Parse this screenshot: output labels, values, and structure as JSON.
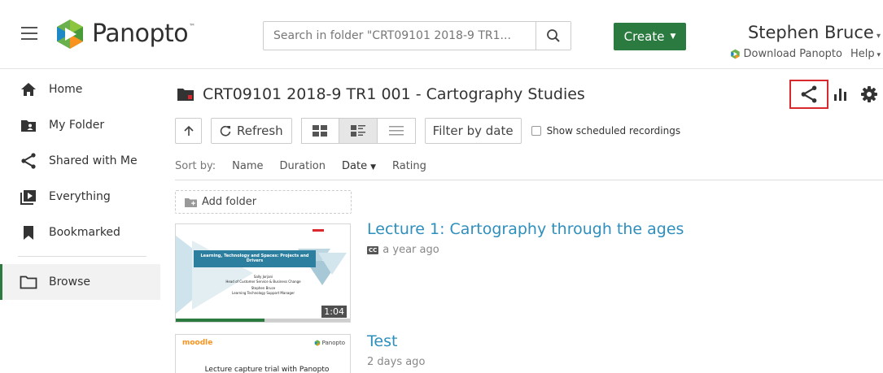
{
  "header": {
    "logo_text": "Panopto",
    "search_placeholder": "Search in folder \"CRT09101 2018-9 TR1...",
    "create_label": "Create",
    "user_name": "Stephen Bruce",
    "download_label": "Download Panopto",
    "help_label": "Help"
  },
  "sidebar": {
    "items": [
      {
        "label": "Home",
        "icon": "home-icon"
      },
      {
        "label": "My Folder",
        "icon": "user-folder-icon"
      },
      {
        "label": "Shared with Me",
        "icon": "share-icon"
      },
      {
        "label": "Everything",
        "icon": "play-box-icon"
      },
      {
        "label": "Bookmarked",
        "icon": "bookmark-icon"
      },
      {
        "label": "Browse",
        "icon": "folder-icon"
      }
    ]
  },
  "main": {
    "folder_title": "CRT09101 2018-9 TR1 001 - Cartography Studies",
    "refresh_label": "Refresh",
    "filter_label": "Filter by date",
    "scheduled_label": "Show scheduled recordings",
    "sort_label": "Sort by:",
    "sort_options": [
      "Name",
      "Duration",
      "Date",
      "Rating"
    ],
    "sort_selected": "Date",
    "add_folder_label": "Add folder"
  },
  "sessions": [
    {
      "title": "Lecture 1: Cartography through the ages",
      "meta": "a year ago",
      "has_captions": true,
      "duration": "1:04",
      "watched_fraction": 0.51,
      "thumb_banner": "Learning, Technology and Spaces: Projects and Drivers",
      "thumb_lines": [
        "Sally Jorjani",
        "Head of Customer Service & Business Change",
        "Stephen Bruce",
        "Learning Technology Support Manager"
      ]
    },
    {
      "title": "Test",
      "meta": "2 days ago",
      "has_captions": false,
      "thumb_logo": "moodle",
      "thumb_brand": "Panopto",
      "thumb_line": "Lecture capture trial with Panopto"
    }
  ],
  "colors": {
    "brand_green": "#2b7a3f",
    "link_blue": "#2e8fbd",
    "highlight_red": "#d9282e"
  }
}
